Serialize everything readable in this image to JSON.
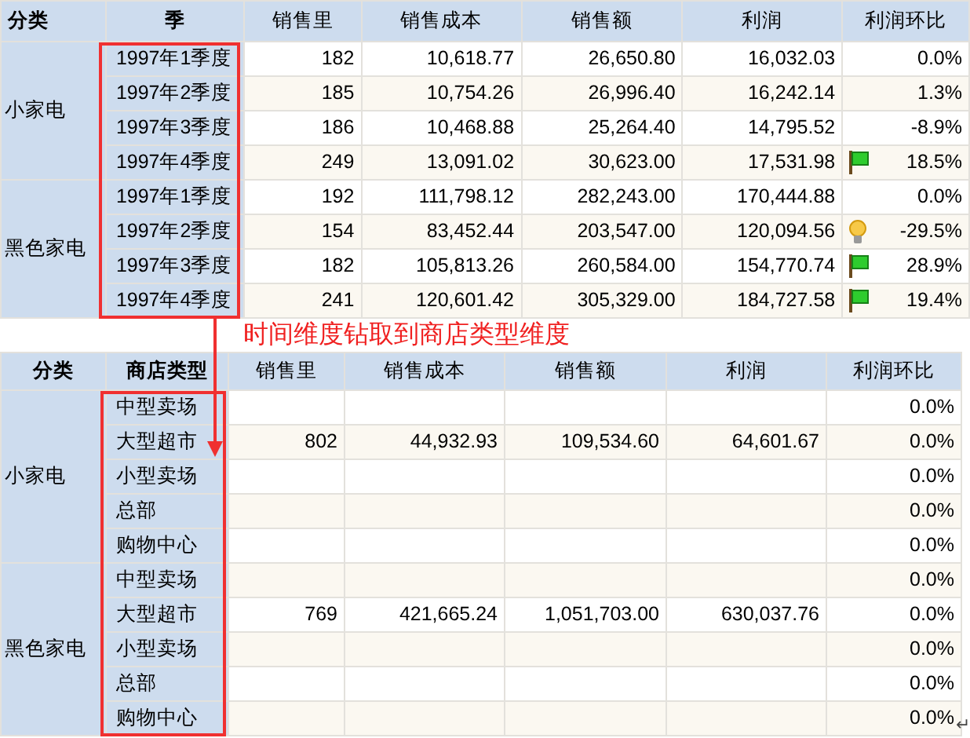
{
  "top_table": {
    "columns": [
      "分类",
      "季",
      "销售里",
      "销售成本",
      "销售额",
      "利润",
      "利润环比"
    ],
    "groups": [
      {
        "category": "小家电",
        "rows": [
          {
            "kind": "plain",
            "period": "1997年1季度",
            "quantity": "182",
            "cost": "10,618.77",
            "sales": "26,650.80",
            "profit": "16,032.03",
            "ratio": "0.0%"
          },
          {
            "kind": "plain",
            "period": "1997年2季度",
            "quantity": "185",
            "cost": "10,754.26",
            "sales": "26,996.40",
            "profit": "16,242.14",
            "ratio": "1.3%"
          },
          {
            "kind": "plain",
            "period": "1997年3季度",
            "quantity": "186",
            "cost": "10,468.88",
            "sales": "25,264.40",
            "profit": "14,795.52",
            "ratio": "-8.9%"
          },
          {
            "kind": "flag",
            "period": "1997年4季度",
            "quantity": "249",
            "cost": "13,091.02",
            "sales": "30,623.00",
            "profit": "17,531.98",
            "ratio": "18.5%"
          }
        ]
      },
      {
        "category": "黑色家电",
        "rows": [
          {
            "kind": "plain",
            "period": "1997年1季度",
            "quantity": "192",
            "cost": "111,798.12",
            "sales": "282,243.00",
            "profit": "170,444.88",
            "ratio": "0.0%"
          },
          {
            "kind": "bulb",
            "period": "1997年2季度",
            "quantity": "154",
            "cost": "83,452.44",
            "sales": "203,547.00",
            "profit": "120,094.56",
            "ratio": "-29.5%"
          },
          {
            "kind": "flag",
            "period": "1997年3季度",
            "quantity": "182",
            "cost": "105,813.26",
            "sales": "260,584.00",
            "profit": "154,770.74",
            "ratio": "28.9%"
          },
          {
            "kind": "flag",
            "period": "1997年4季度",
            "quantity": "241",
            "cost": "120,601.42",
            "sales": "305,329.00",
            "profit": "184,727.58",
            "ratio": "19.4%"
          }
        ]
      }
    ]
  },
  "annotation": {
    "text": "时间维度钻取到商店类型维度"
  },
  "bottom_table": {
    "columns": [
      "分类",
      "商店类型",
      "销售里",
      "销售成本",
      "销售额",
      "利润",
      "利润环比"
    ],
    "groups": [
      {
        "category": "小家电",
        "rows": [
          {
            "period": "中型卖场",
            "ratio": "0.0%"
          },
          {
            "period": "大型超市",
            "quantity": "802",
            "cost": "44,932.93",
            "sales": "109,534.60",
            "profit": "64,601.67",
            "ratio": "0.0%"
          },
          {
            "period": "小型卖场",
            "ratio": "0.0%"
          },
          {
            "period": "总部",
            "ratio": "0.0%"
          },
          {
            "period": "购物中心",
            "ratio": "0.0%"
          }
        ]
      },
      {
        "category": "黑色家电",
        "rows": [
          {
            "period": "中型卖场",
            "ratio": "0.0%"
          },
          {
            "period": "大型超市",
            "quantity": "769",
            "cost": "421,665.24",
            "sales": "1,051,703.00",
            "profit": "630,037.76",
            "ratio": "0.0%"
          },
          {
            "period": "小型卖场",
            "ratio": "0.0%"
          },
          {
            "period": "总部",
            "ratio": "0.0%"
          },
          {
            "period": "购物中心",
            "ratio": "0.0%"
          }
        ]
      }
    ]
  },
  "paragraph_mark": "↵"
}
